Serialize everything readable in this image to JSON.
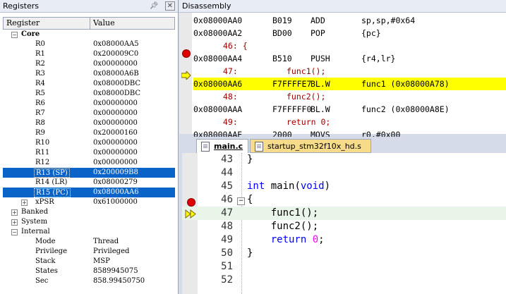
{
  "registers_panel": {
    "title": "Registers",
    "col_register": "Register",
    "col_value": "Value",
    "groups": {
      "core": "Core",
      "banked": "Banked",
      "system": "System",
      "internal": "Internal"
    },
    "core": [
      {
        "name": "R0",
        "value": "0x08000AA5"
      },
      {
        "name": "R1",
        "value": "0x200009C0"
      },
      {
        "name": "R2",
        "value": "0x00000000"
      },
      {
        "name": "R3",
        "value": "0x08000A6B"
      },
      {
        "name": "R4",
        "value": "0x08000DBC"
      },
      {
        "name": "R5",
        "value": "0x08000DBC"
      },
      {
        "name": "R6",
        "value": "0x00000000"
      },
      {
        "name": "R7",
        "value": "0x00000000"
      },
      {
        "name": "R8",
        "value": "0x00000000"
      },
      {
        "name": "R9",
        "value": "0x20000160"
      },
      {
        "name": "R10",
        "value": "0x00000000"
      },
      {
        "name": "R11",
        "value": "0x00000000"
      },
      {
        "name": "R12",
        "value": "0x00000000"
      },
      {
        "name": "R13 (SP)",
        "value": "0x200009B8"
      },
      {
        "name": "R14 (LR)",
        "value": "0x08000279"
      },
      {
        "name": "R15 (PC)",
        "value": "0x08000AA6"
      },
      {
        "name": "xPSR",
        "value": "0x61000000"
      }
    ],
    "internal": [
      {
        "name": "Mode",
        "value": "Thread"
      },
      {
        "name": "Privilege",
        "value": "Privileged"
      },
      {
        "name": "Stack",
        "value": "MSP"
      },
      {
        "name": "States",
        "value": "8589945075"
      },
      {
        "name": "Sec",
        "value": "858.99450750"
      }
    ]
  },
  "disassembly": {
    "title": "Disassembly",
    "lines": [
      {
        "addr": "0x08000AA0",
        "op": "B019",
        "mn": "ADD",
        "args": "sp,sp,#0x64"
      },
      {
        "addr": "0x08000AA2",
        "op": "BD00",
        "mn": "POP",
        "args": "{pc}"
      },
      {
        "src": "46: {"
      },
      {
        "addr": "0x08000AA4",
        "op": "B510",
        "mn": "PUSH",
        "args": "{r4,lr}"
      },
      {
        "src": "47:          func1();"
      },
      {
        "addr": "0x08000AA6",
        "op": "F7FFFFE7",
        "mn": "BL.W",
        "args": "func1 (0x08000A78)"
      },
      {
        "src": "48:          func2();"
      },
      {
        "addr": "0x08000AAA",
        "op": "F7FFFFF0",
        "mn": "BL.W",
        "args": "func2 (0x08000A8E)"
      },
      {
        "src": "49:          return 0;"
      },
      {
        "addr": "0x08000AAE",
        "op": "2000",
        "mn": "MOVS",
        "args": "r0,#0x00"
      }
    ]
  },
  "tabs": [
    {
      "label": "main.c"
    },
    {
      "label": "startup_stm32f10x_hd.s"
    }
  ],
  "editor": {
    "lines": [
      {
        "n": "43",
        "code": "}"
      },
      {
        "n": "44",
        "code": ""
      },
      {
        "n": "45",
        "code": "int main(void)"
      },
      {
        "n": "46",
        "code": "{"
      },
      {
        "n": "47",
        "code": "    func1();"
      },
      {
        "n": "48",
        "code": "    func2();"
      },
      {
        "n": "49",
        "code": "    return 0;"
      },
      {
        "n": "50",
        "code": "}"
      },
      {
        "n": "51",
        "code": ""
      },
      {
        "n": "52",
        "code": ""
      }
    ]
  },
  "colors": {
    "selection": "#0a64c8",
    "current_line": "#ffff00",
    "breakpoint": "#e00000",
    "keyword": "#0000ff",
    "number": "#ff00ff"
  }
}
